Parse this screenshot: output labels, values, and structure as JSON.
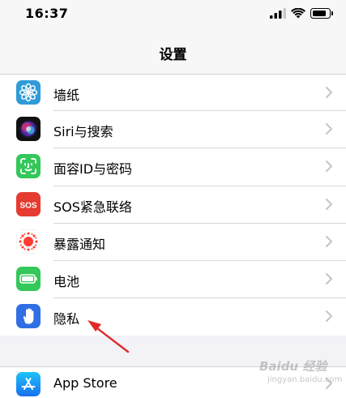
{
  "status_bar": {
    "time": "16:37",
    "icons": [
      "signal-icon",
      "wifi-icon",
      "battery-icon"
    ]
  },
  "nav": {
    "title": "设置"
  },
  "settings": {
    "items": [
      {
        "label": "墙纸",
        "icon": "wallpaper-icon",
        "color": "#2f9bd8"
      },
      {
        "label": "Siri与搜索",
        "icon": "siri-icon",
        "color": "#1b1b2f"
      },
      {
        "label": "面容ID与密码",
        "icon": "face-id-icon",
        "color": "#34c759"
      },
      {
        "label": "SOS紧急联络",
        "icon": "sos-icon",
        "color": "#e53b30"
      },
      {
        "label": "暴露通知",
        "icon": "exposure-notification-icon",
        "color": "#ff3b30"
      },
      {
        "label": "电池",
        "icon": "battery-settings-icon",
        "color": "#34c759"
      },
      {
        "label": "隐私",
        "icon": "privacy-hand-icon",
        "color": "#2f6fe3"
      }
    ],
    "store_items": [
      {
        "label": "App Store",
        "icon": "app-store-icon",
        "color": "#1f8ef7"
      }
    ]
  },
  "sos_badge_text": "SOS",
  "watermark": {
    "logo": "Baidu 经验",
    "sub": "jingyan.baidu.com"
  },
  "colors": {
    "accent_arrow": "#e02a2a",
    "separator": "#d9d9de",
    "background": "#f2f2f7"
  }
}
